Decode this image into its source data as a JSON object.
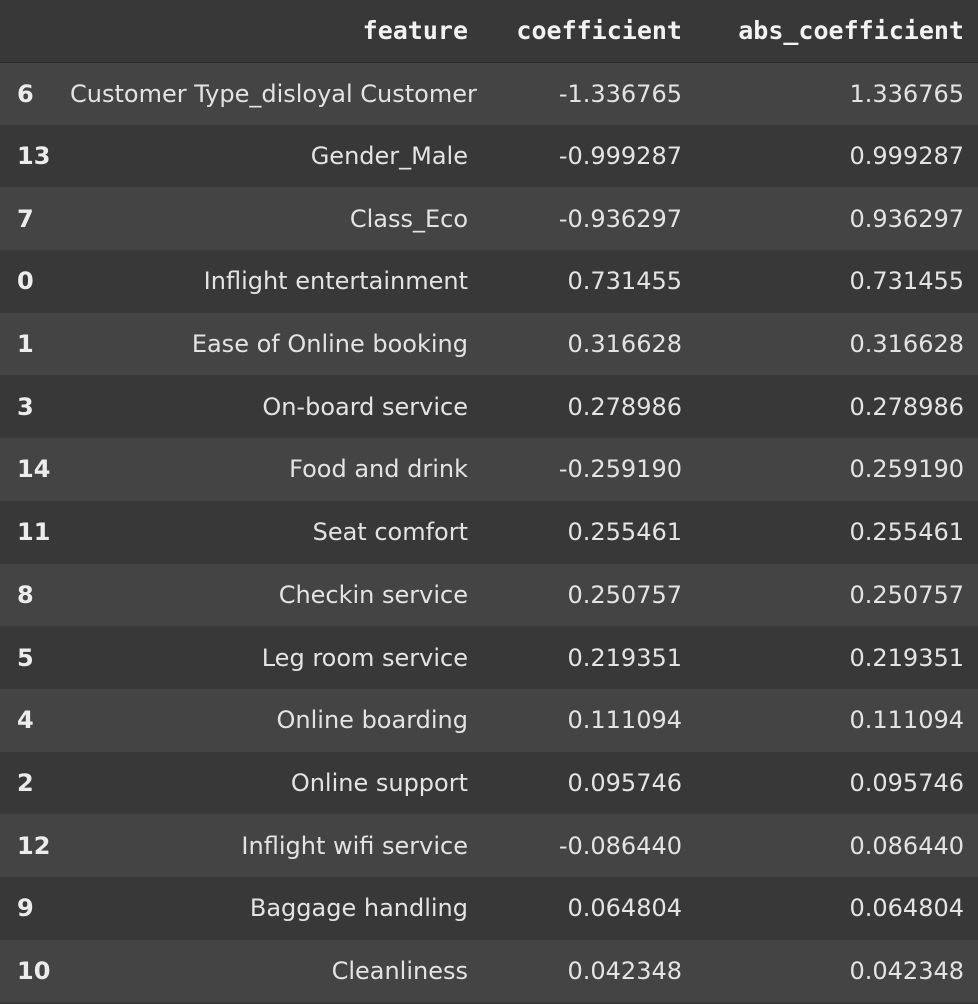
{
  "table": {
    "columns": [
      "",
      "feature",
      "coefficient",
      "abs_coefficient"
    ],
    "rows": [
      {
        "index": "6",
        "feature": "Customer Type_disloyal Customer",
        "coefficient": "-1.336765",
        "abs_coefficient": "1.336765"
      },
      {
        "index": "13",
        "feature": "Gender_Male",
        "coefficient": "-0.999287",
        "abs_coefficient": "0.999287"
      },
      {
        "index": "7",
        "feature": "Class_Eco",
        "coefficient": "-0.936297",
        "abs_coefficient": "0.936297"
      },
      {
        "index": "0",
        "feature": "Inflight entertainment",
        "coefficient": "0.731455",
        "abs_coefficient": "0.731455"
      },
      {
        "index": "1",
        "feature": "Ease of Online booking",
        "coefficient": "0.316628",
        "abs_coefficient": "0.316628"
      },
      {
        "index": "3",
        "feature": "On-board service",
        "coefficient": "0.278986",
        "abs_coefficient": "0.278986"
      },
      {
        "index": "14",
        "feature": "Food and drink",
        "coefficient": "-0.259190",
        "abs_coefficient": "0.259190"
      },
      {
        "index": "11",
        "feature": "Seat comfort",
        "coefficient": "0.255461",
        "abs_coefficient": "0.255461"
      },
      {
        "index": "8",
        "feature": "Checkin service",
        "coefficient": "0.250757",
        "abs_coefficient": "0.250757"
      },
      {
        "index": "5",
        "feature": "Leg room service",
        "coefficient": "0.219351",
        "abs_coefficient": "0.219351"
      },
      {
        "index": "4",
        "feature": "Online boarding",
        "coefficient": "0.111094",
        "abs_coefficient": "0.111094"
      },
      {
        "index": "2",
        "feature": "Online support",
        "coefficient": "0.095746",
        "abs_coefficient": "0.095746"
      },
      {
        "index": "12",
        "feature": "Inflight wifi service",
        "coefficient": "-0.086440",
        "abs_coefficient": "0.086440"
      },
      {
        "index": "9",
        "feature": "Baggage handling",
        "coefficient": "0.064804",
        "abs_coefficient": "0.064804"
      },
      {
        "index": "10",
        "feature": "Cleanliness",
        "coefficient": "0.042348",
        "abs_coefficient": "0.042348"
      }
    ]
  },
  "colors": {
    "background": "#383838",
    "row_stripe": "#444444",
    "text": "#e6e6e6"
  }
}
